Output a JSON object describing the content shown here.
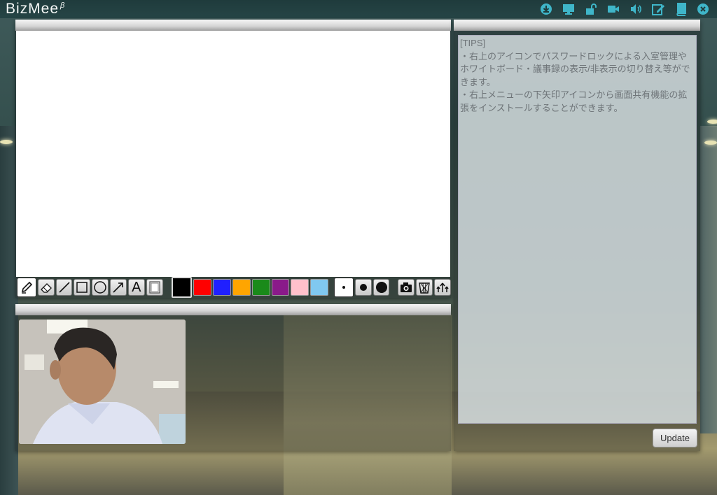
{
  "app": {
    "name": "BizMee",
    "superscript": "β"
  },
  "header": {
    "icons": [
      "download-icon",
      "screen-share-icon",
      "unlock-icon",
      "video-camera-icon",
      "speaker-icon",
      "notes-edit-icon",
      "book-icon",
      "close-circle-icon"
    ],
    "icon_color": "#3fb6c9"
  },
  "whiteboard": {
    "tools": [
      "pen",
      "eraser",
      "line",
      "rectangle",
      "circle",
      "arrow",
      "text",
      "clear-frame"
    ],
    "text_tool_label": "A",
    "colors": [
      "#000000",
      "#ff0000",
      "#2020ff",
      "#ffa500",
      "#1a8a1a",
      "#8a1a8a",
      "#ffc0cb",
      "#80c8f0"
    ],
    "selected_color": "#000000",
    "pen_sizes": [
      "small",
      "medium",
      "large"
    ],
    "selected_size": "small",
    "extra_tools": [
      "camera-capture",
      "trash-basket",
      "export"
    ]
  },
  "tips": {
    "lines": [
      "[TIPS]",
      "・右上のアイコンでパスワードロックによる入室管理やホワイトボード・議事録の表示/非表示の切り替え等ができます。",
      "・右上メニューの下矢印アイコンから画面共有機能の拡張をインストールすることができます。"
    ],
    "update_label": "Update"
  }
}
